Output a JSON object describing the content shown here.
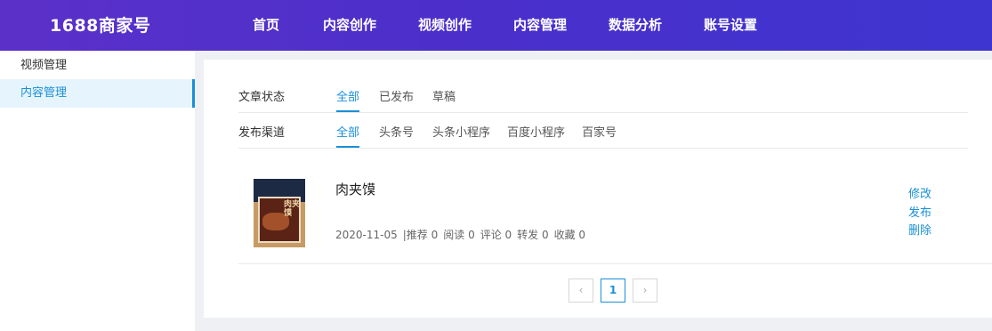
{
  "brand": "1688商家号",
  "nav": [
    "首页",
    "内容创作",
    "视频创作",
    "内容管理",
    "数据分析",
    "账号设置"
  ],
  "sidebar": {
    "items": [
      {
        "label": "视频管理"
      },
      {
        "label": "内容管理",
        "active": true
      }
    ]
  },
  "filters": {
    "status": {
      "label": "文章状态",
      "options": [
        "全部",
        "已发布",
        "草稿"
      ],
      "selected": "全部"
    },
    "channel": {
      "label": "发布渠道",
      "options": [
        "全部",
        "头条号",
        "头条小程序",
        "百度小程序",
        "百家号"
      ],
      "selected": "全部"
    }
  },
  "article": {
    "title": "肉夹馍",
    "date": "2020-11-05",
    "stats": {
      "recommend": "|推荐 0",
      "read": "阅读 0",
      "comment": "评论 0",
      "share": "转发 0",
      "favorite": "收藏 0"
    },
    "actions": {
      "edit": "修改",
      "publish": "发布",
      "delete": "删除"
    },
    "thumb_text": "肉夹馍"
  },
  "pagination": {
    "prev": "‹",
    "current": "1",
    "next": "›"
  },
  "colors": {
    "accent": "#1a8fd9",
    "header_start": "#5b30c9",
    "header_end": "#3e35d0"
  }
}
